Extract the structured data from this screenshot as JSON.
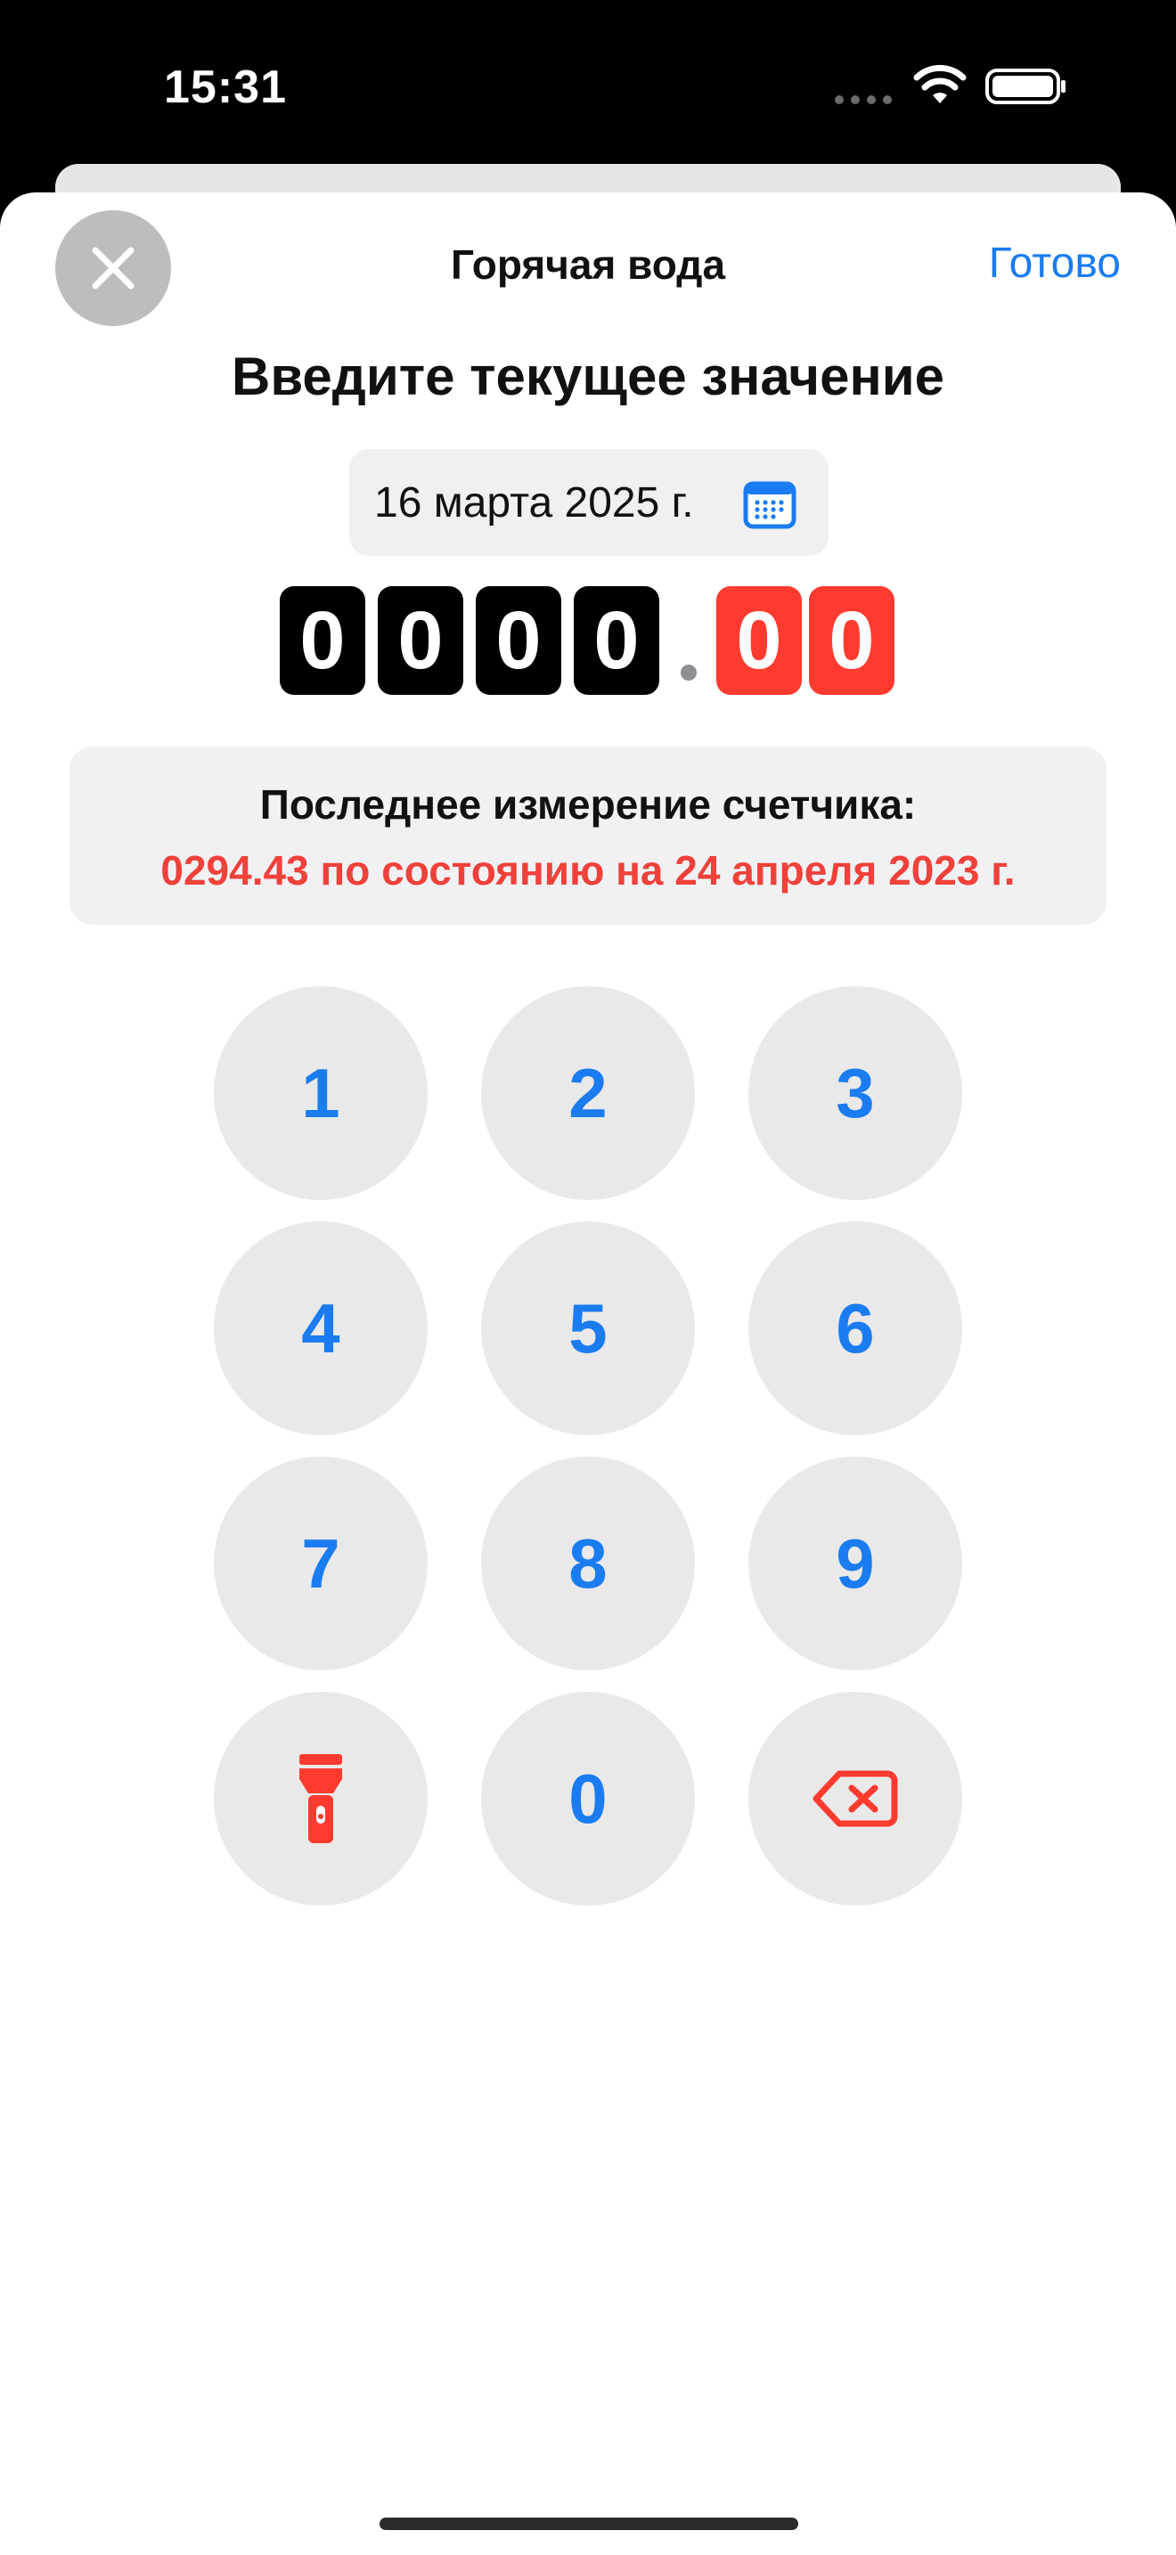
{
  "status_bar": {
    "time": "15:31"
  },
  "nav": {
    "title": "Горячая вода",
    "done_label": "Готово"
  },
  "heading": "Введите текущее значение",
  "date": {
    "label": "16 марта 2025 г."
  },
  "reading": {
    "integer_digits": [
      "0",
      "0",
      "0",
      "0"
    ],
    "decimal_digits": [
      "0",
      "0"
    ]
  },
  "last_measurement": {
    "title": "Последнее измерение счетчика:",
    "value": "0294.43 по состоянию на 24 апреля 2023 г."
  },
  "keypad": {
    "keys": [
      "1",
      "2",
      "3",
      "4",
      "5",
      "6",
      "7",
      "8",
      "9",
      "0"
    ],
    "left_bottom_icon": "flashlight-icon",
    "right_bottom_icon": "delete-backspace-icon"
  },
  "colors": {
    "accent_blue": "#1a7cf0",
    "accent_red": "#ff3b30"
  }
}
